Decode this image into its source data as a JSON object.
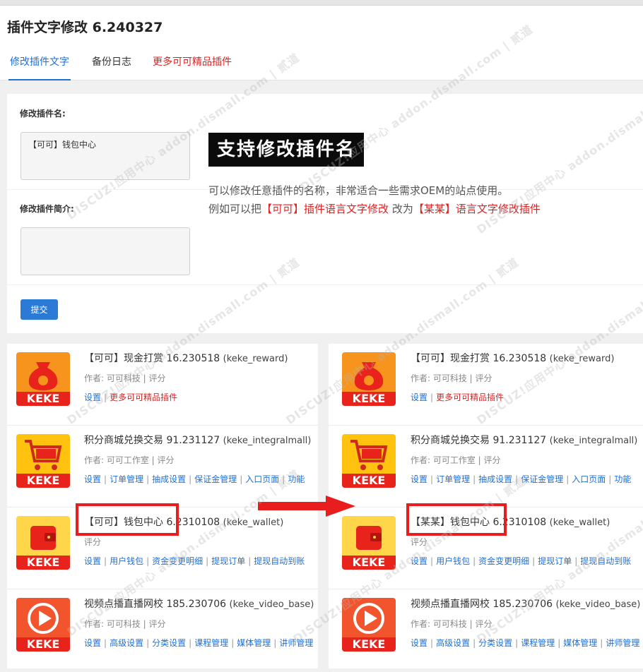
{
  "app": {
    "title": "插件文字修改 6.240327"
  },
  "tabs": [
    {
      "label": "修改插件文字"
    },
    {
      "label": "备份日志"
    },
    {
      "label": "更多可可精品插件"
    }
  ],
  "form": {
    "name_label": "修改插件名:",
    "name_value": "【可可】钱包中心",
    "intro_label": "修改插件简介:",
    "intro_value": "",
    "submit_label": "提交"
  },
  "promo": {
    "banner": "支持修改插件名",
    "line1": "可以修改任意插件的名称，非常适合一些需求OEM的站点使用。",
    "line2_prefix": "例如可以把",
    "line2_from": "【可可】插件语言文字修改",
    "line2_mid": "改为",
    "line2_to": "【某某】语言文字修改插件"
  },
  "brand_text": "KEKE",
  "watermark_text": "DISCUZ!应用中心 addon.dismall.com | 贰道",
  "colors": {
    "accent": "#1e6fd9",
    "highlight": "#e81e1e",
    "brand_red": "#e8231b"
  },
  "left_list": [
    {
      "name": "【可可】现金打赏",
      "version": "16.230518",
      "ident": "(keke_reward)",
      "meta": "作者: 可可科技 | 评分",
      "links": [
        "设置",
        "更多可可精品插件"
      ],
      "icon": "money-bag-icon"
    },
    {
      "name": "积分商城兑换交易",
      "version": "91.231127",
      "ident": "(keke_integralmall)",
      "meta": "作者: 可可工作室 | 评分",
      "links": [
        "设置",
        "订单管理",
        "抽成设置",
        "保证金管理",
        "入口页面",
        "功能"
      ],
      "icon": "shopping-cart-icon"
    },
    {
      "name": "【可可】钱包中心",
      "version": "6.2310108",
      "ident": "(keke_wallet)",
      "meta": "评分",
      "links": [
        "设置",
        "用户钱包",
        "资金变更明细",
        "提现订单",
        "提现自动到账"
      ],
      "icon": "wallet-icon"
    },
    {
      "name": "视频点播直播网校",
      "version": "185.230706",
      "ident": "(keke_video_base)",
      "meta": "作者: 可可科技 | 评分",
      "links": [
        "设置",
        "高级设置",
        "分类设置",
        "课程管理",
        "媒体管理",
        "讲师管理"
      ],
      "icon": "play-icon"
    }
  ],
  "right_list": [
    {
      "name": "【可可】现金打赏",
      "version": "16.230518",
      "ident": "(keke_reward)",
      "meta": "作者: 可可科技 | 评分",
      "links": [
        "设置",
        "更多可可精品插件"
      ],
      "icon": "money-bag-icon"
    },
    {
      "name": "积分商城兑换交易",
      "version": "91.231127",
      "ident": "(keke_integralmall)",
      "meta": "作者: 可可工作室 | 评分",
      "links": [
        "设置",
        "订单管理",
        "抽成设置",
        "保证金管理",
        "入口页面",
        "功能"
      ],
      "icon": "shopping-cart-icon"
    },
    {
      "name": "【某某】钱包中心",
      "version": "6.2310108",
      "ident": "(keke_wallet)",
      "meta": "评分",
      "links": [
        "设置",
        "用户钱包",
        "资金变更明细",
        "提现订单",
        "提现自动到账"
      ],
      "icon": "wallet-icon"
    },
    {
      "name": "视频点播直播网校",
      "version": "185.230706",
      "ident": "(keke_video_base)",
      "meta": "作者: 可可科技 | 评分",
      "links": [
        "设置",
        "高级设置",
        "分类设置",
        "课程管理",
        "媒体管理",
        "讲师管理"
      ],
      "icon": "play-icon"
    }
  ]
}
